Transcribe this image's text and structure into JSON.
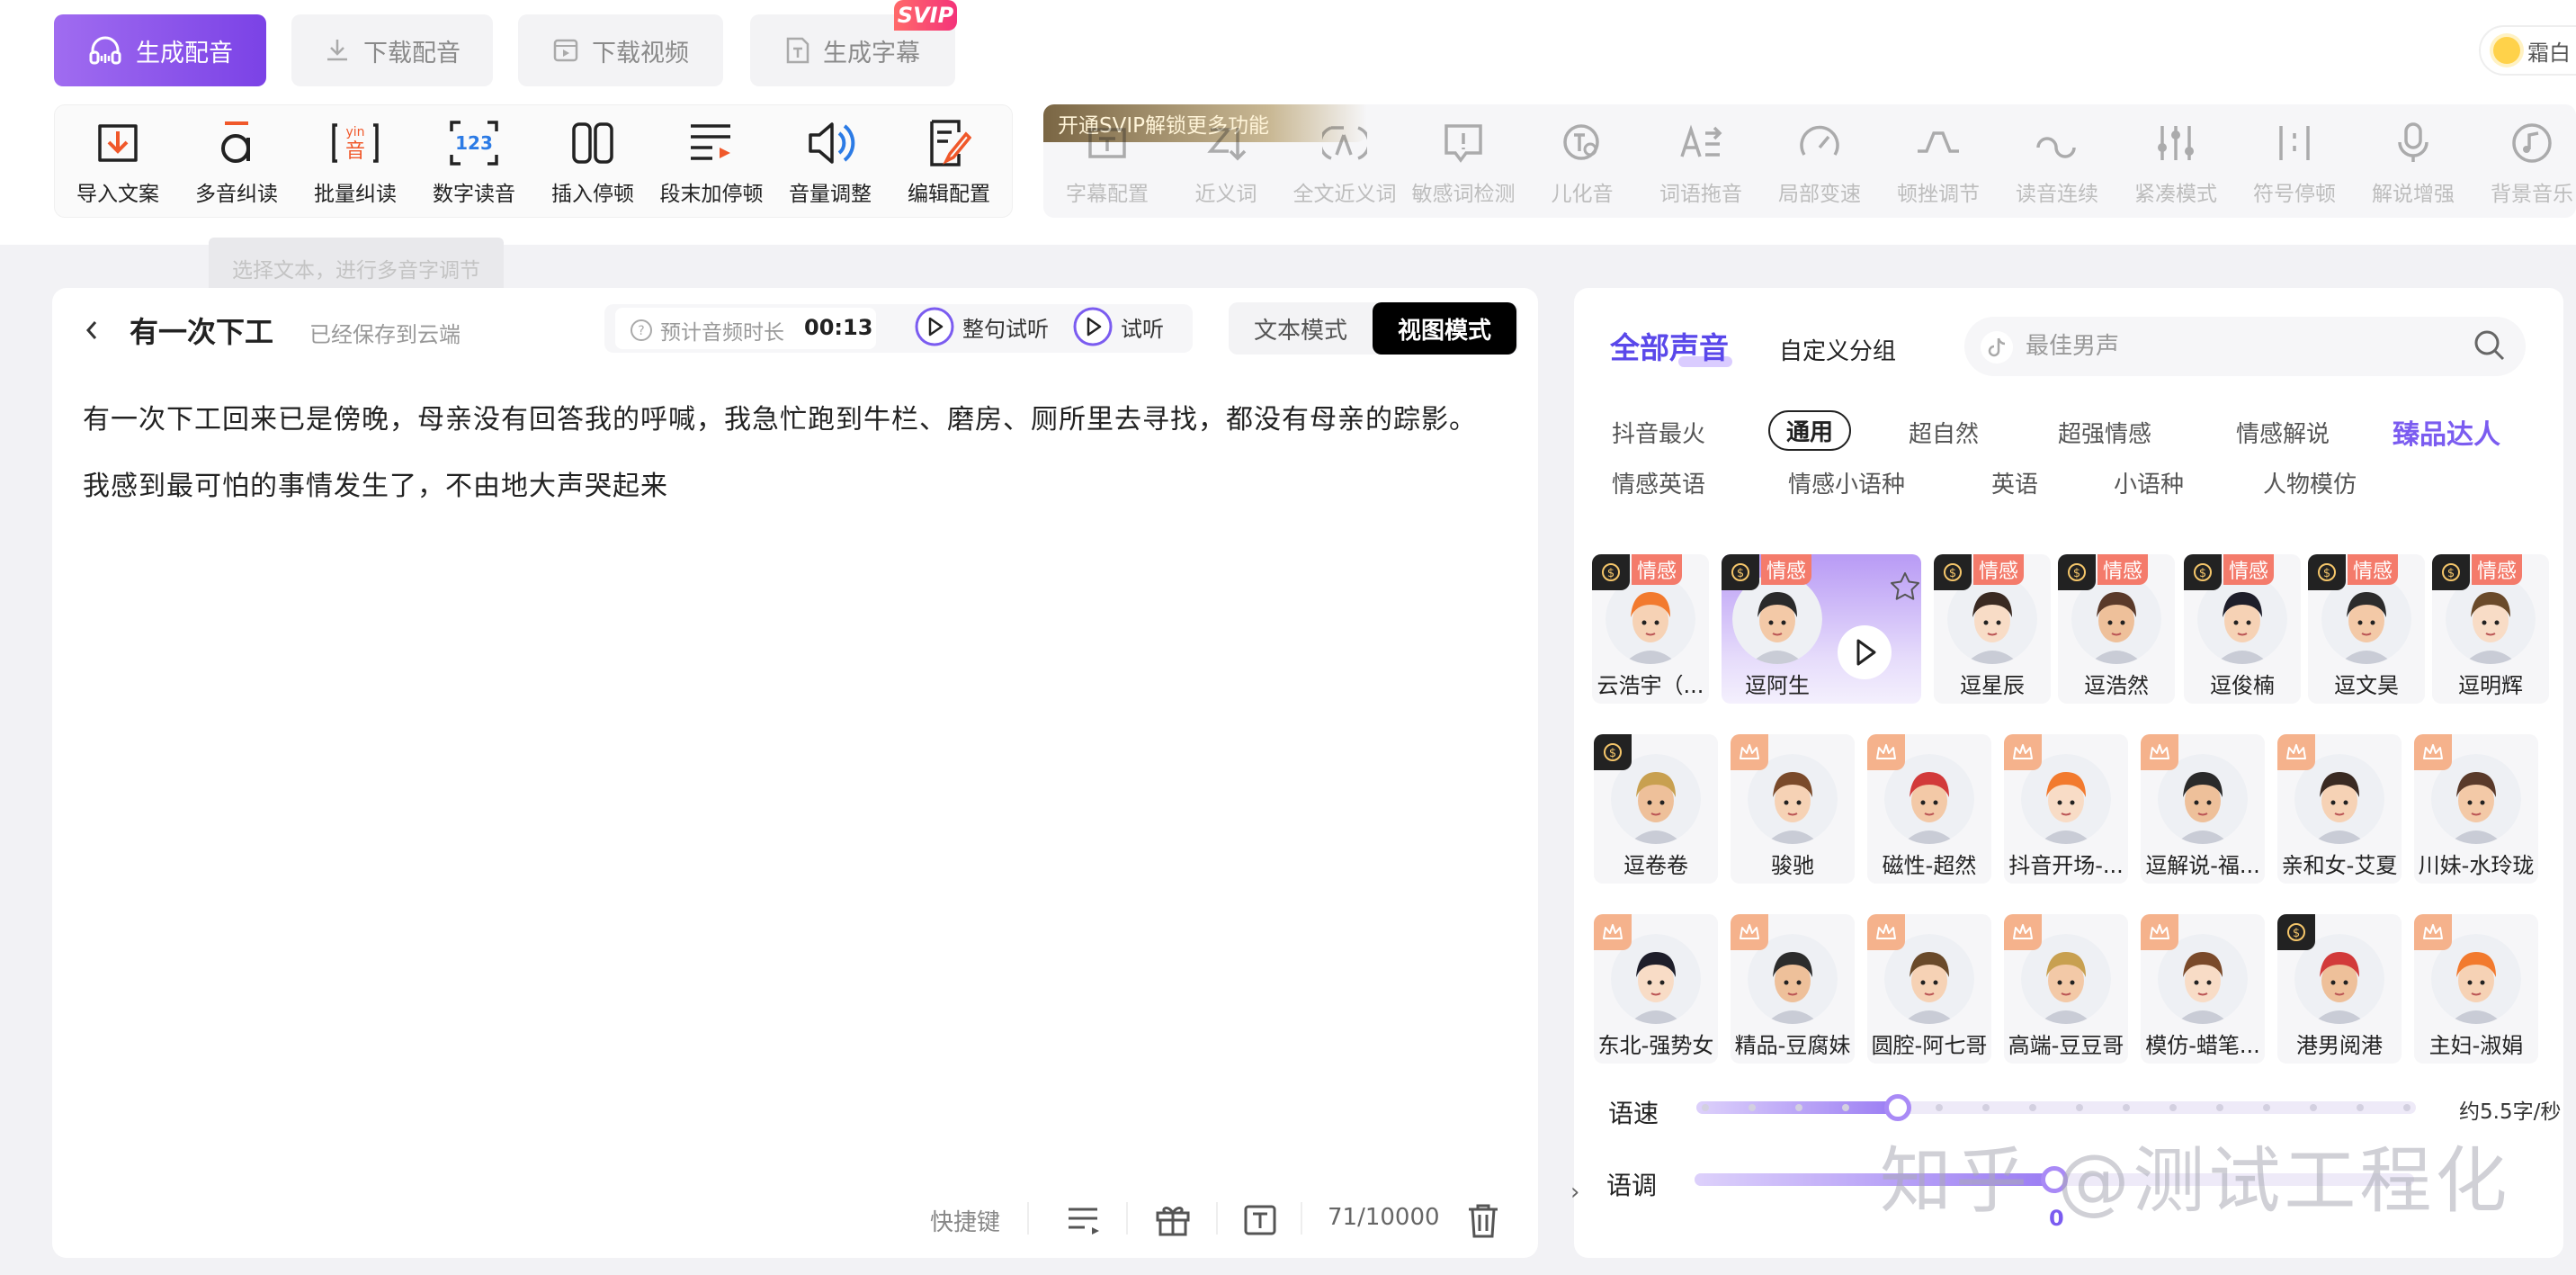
{
  "top_tabs": {
    "generate": "生成配音",
    "download_audio": "下载配音",
    "download_video": "下载视频",
    "generate_subtitle": "生成字幕",
    "svip_badge": "SVIP"
  },
  "user": {
    "name": "霜白"
  },
  "tools": [
    "导入文案",
    "多音纠读",
    "批量纠读",
    "数字读音",
    "插入停顿",
    "段末加停顿",
    "音量调整",
    "编辑配置"
  ],
  "svip_banner": "开通SVIP解锁更多功能",
  "svip_tools": [
    "字幕配置",
    "近义词",
    "全文近义词",
    "敏感词检测",
    "儿化音",
    "词语拖音",
    "局部变速",
    "顿挫调节",
    "读音连续",
    "紧凑模式",
    "符号停顿",
    "解说增强",
    "背景音乐"
  ],
  "tooltip": "选择文本，进行多音字调节",
  "editor": {
    "title": "有一次下工",
    "saved": "已经保存到云端",
    "duration_label": "预计音频时长",
    "duration": "00:13",
    "sentence_listen": "整句试听",
    "listen": "试听",
    "mode_text": "文本模式",
    "mode_view": "视图模式",
    "content": "有一次下工回来已是傍晚，母亲没有回答我的呼喊，我急忙跑到牛栏、磨房、厕所里去寻找，都没有母亲的踪影。我感到最可怕的事情发生了，不由地大声哭起来",
    "shortcut": "快捷键",
    "count": "71/10000"
  },
  "voices_panel": {
    "tab_all": "全部声音",
    "tab_custom": "自定义分组",
    "search_placeholder": "最佳男声",
    "categories_row1": [
      "抖音最火",
      "通用",
      "超自然",
      "超强情感",
      "情感解说",
      "臻品达人"
    ],
    "categories_row2": [
      "情感英语",
      "情感小语种",
      "英语",
      "小语种",
      "人物模仿"
    ],
    "active_category": "通用",
    "emotion_tag": "情感",
    "row1": [
      "云浩宇（...",
      "逗阿生",
      "逗星辰",
      "逗浩然",
      "逗俊楠",
      "逗文昊",
      "逗明辉"
    ],
    "row2": [
      "逗卷卷",
      "骏驰",
      "磁性-超然",
      "抖音开场-...",
      "逗解说-福...",
      "亲和女-艾夏",
      "川妹-水玲珑"
    ],
    "row3": [
      "东北-强势女",
      "精品-豆腐妹",
      "圆腔-阿七哥",
      "高端-豆豆哥",
      "模仿-蜡笔...",
      "港男阅港",
      "主妇-淑娟"
    ],
    "speed_label": "语速",
    "speed_value": "约5.5字/秒",
    "speed_level": 0.28,
    "pitch_label": "语调",
    "pitch_value": "0",
    "pitch_level": 0.5
  },
  "watermark": "知乎 @测试工程化",
  "colors": {
    "accent": "#7b42e6",
    "emotion_tag": "#f47b6b",
    "crown": "#f5b28c"
  }
}
